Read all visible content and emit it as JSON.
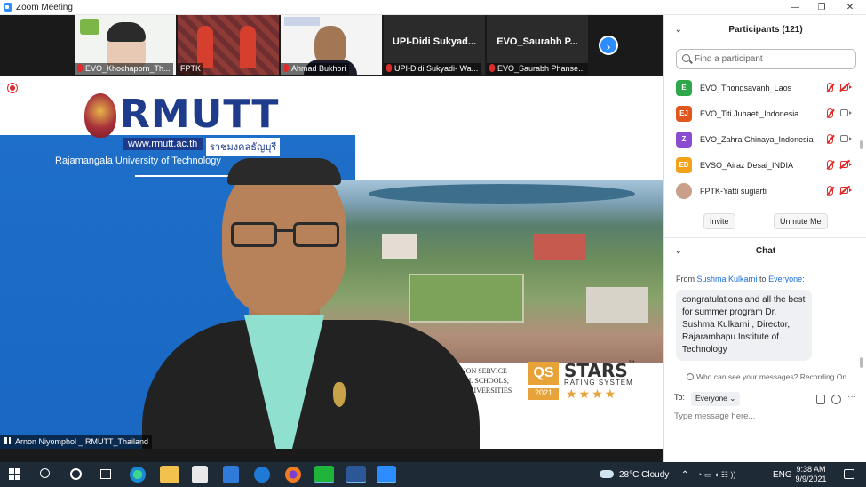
{
  "window": {
    "title": "Zoom Meeting",
    "minimize": "—",
    "restore": "❐",
    "close": "✕"
  },
  "thumbnails": [
    {
      "label": "EVO_Khochaporn_Th..."
    },
    {
      "label": "FPTK"
    },
    {
      "label": "Ahmad Bukhori"
    },
    {
      "label": "UPI-Didi Sukyadi- Wa...",
      "name": "UPI-Didi  Sukyad..."
    },
    {
      "label": "EVO_Saurabh Phanse...",
      "name": "EVO_Saurabh  P..."
    }
  ],
  "next_button": "›",
  "slide": {
    "brand": "RMUTT",
    "website": "www.rmutt.ac.th",
    "thai": "ราชมงคลธัญบุรี",
    "university": "Rajamangala University of Technology",
    "service_lines": [
      "ION SERVICE",
      "AL SCHOOLS,",
      "UNIVERSITIES"
    ],
    "qs": "QS",
    "stars": "STARS",
    "tm": "™",
    "rating_system": "RATING SYSTEM",
    "year": "2021",
    "star_glyphs": "★★★★"
  },
  "speaker_label": "Arnon Niyomphol _ RMUTT_Thailand",
  "participants": {
    "title": "Participants (121)",
    "search_placeholder": "Find a participant",
    "rows": [
      {
        "initials": "E",
        "color": "#2ea84a",
        "name": "EVO_Thongsavanh_Laos",
        "cam": "off"
      },
      {
        "initials": "EJ",
        "color": "#e0561c",
        "name": "EVO_Titi Juhaeti_Indonesia",
        "cam": "on"
      },
      {
        "initials": "Z",
        "color": "#8a4bd1",
        "name": "EVO_Zahra Ghinaya_Indonesia",
        "cam": "on"
      },
      {
        "initials": "ED",
        "color": "#f0a21b",
        "name": "EVSO_Airaz Desai_INDIA",
        "cam": "off"
      },
      {
        "initials": "",
        "color": "#c9a089",
        "name": "FPTK-Yatti sugiarti",
        "cam": "off"
      }
    ],
    "invite": "Invite",
    "unmute": "Unmute Me"
  },
  "chat": {
    "title": "Chat",
    "from_prefix": "From ",
    "from_name": "Sushma Kulkarni",
    "to_word": " to ",
    "to_name": "Everyone",
    "colon": ":",
    "message": "congratulations and all the best for summer program Dr. Sushma Kulkarni , Director, Rajarambapu Institute of Technology",
    "notice": "Who can see your messages? Recording On",
    "to_label": "To:",
    "recipient": "Everyone",
    "caret": "⌄",
    "more": "···",
    "input_placeholder": "Type message here..."
  },
  "taskbar": {
    "weather": "28°C  Cloudy",
    "lang": "ENG",
    "time": "9:38 AM",
    "date": "9/9/2021",
    "tray_caret": "⌃",
    "tray_icons": "◔ ▭ ◖ ☷ ))"
  }
}
